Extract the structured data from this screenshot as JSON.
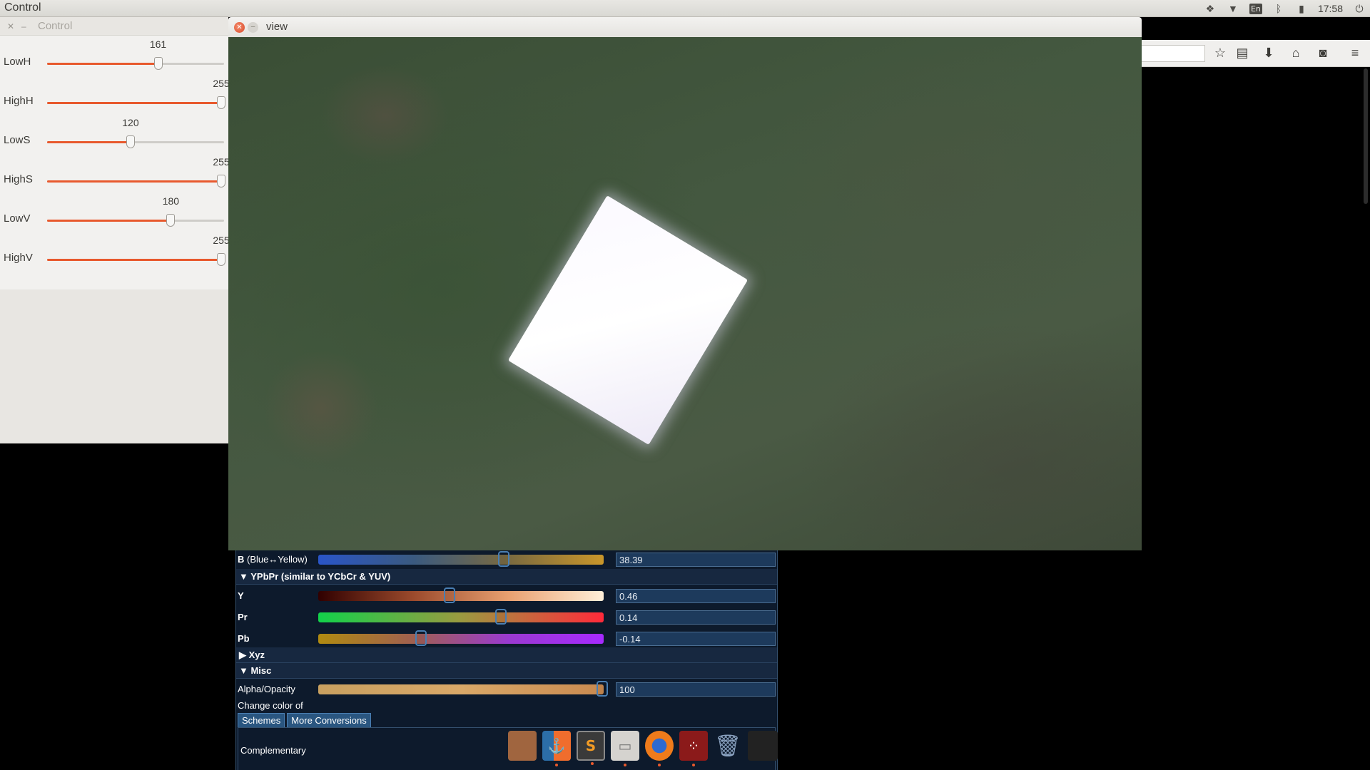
{
  "top_panel": {
    "app_title": "Control",
    "keyboard_layout": "En",
    "clock": "17:58",
    "tray_icons": [
      "dropbox-icon",
      "wifi-icon",
      "keyboard-icon",
      "bluetooth-icon",
      "battery-icon",
      "clock",
      "power-icon"
    ]
  },
  "control_window": {
    "title": "Control",
    "trackbars": [
      {
        "label": "LowH",
        "value": "161",
        "max": 255
      },
      {
        "label": "HighH",
        "value": "255",
        "max": 255
      },
      {
        "label": "LowS",
        "value": "120",
        "max": 255
      },
      {
        "label": "HighS",
        "value": "255",
        "max": 255
      },
      {
        "label": "LowV",
        "value": "180",
        "max": 255
      },
      {
        "label": "HighV",
        "value": "255",
        "max": 255
      }
    ]
  },
  "view_window": {
    "title": "view"
  },
  "browser": {
    "icons": [
      "bookmark-star-icon",
      "reading-list-icon",
      "download-icon",
      "home-icon",
      "pocket-icon",
      "menu-icon"
    ]
  },
  "color_tool": {
    "b_row": {
      "label": "B",
      "sublabel": "(Blue↔Yellow)",
      "value": "38.39",
      "fraction": 0.65
    },
    "ypbpr_section": "▼ YPbPr (similar to YCbCr & YUV)",
    "rows": [
      {
        "label": "Y",
        "value": "0.46",
        "fraction": 0.46
      },
      {
        "label": "Pr",
        "value": "0.14",
        "fraction": 0.64
      },
      {
        "label": "Pb",
        "value": "-0.14",
        "fraction": 0.36
      }
    ],
    "xyz_section": "▶ Xyz",
    "misc_section": "▼ Misc",
    "alpha": {
      "label": "Alpha/Opacity",
      "value": "100",
      "fraction": 1.0
    },
    "change_color_label": "Change color of",
    "tabs": [
      "Schemes",
      "More Conversions"
    ],
    "scheme_label": "Complementary"
  },
  "dock": {
    "items": [
      "color-picker-icon",
      "chart-app-icon",
      "sublime-text-icon",
      "files-icon",
      "firefox-icon",
      "red-app-icon",
      "trash-icon",
      "workspace-switcher-icon"
    ],
    "sublime_letter": "S"
  }
}
